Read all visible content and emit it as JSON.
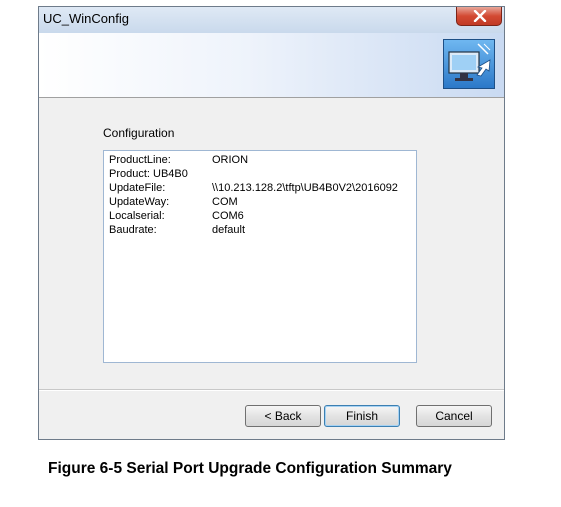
{
  "window": {
    "title": "UC_WinConfig",
    "close_symbol": "✕"
  },
  "header": {
    "icon": "config-wizard-monitor-icon"
  },
  "configuration": {
    "label": "Configuration",
    "rows": [
      {
        "key": "ProductLine:",
        "value": "ORION"
      },
      {
        "key": "Product:  UB4B0",
        "value": ""
      },
      {
        "key": "UpdateFile:",
        "value": "\\\\10.213.128.2\\tftp\\UB4B0V2\\2016092"
      },
      {
        "key": "UpdateWay:",
        "value": "COM"
      },
      {
        "key": "Localserial:",
        "value": "COM6"
      },
      {
        "key": "Baudrate:",
        "value": "default"
      }
    ]
  },
  "buttons": {
    "back": "< Back",
    "finish": "Finish",
    "cancel": "Cancel"
  },
  "caption": "Figure 6-5 Serial Port Upgrade Configuration Summary"
}
